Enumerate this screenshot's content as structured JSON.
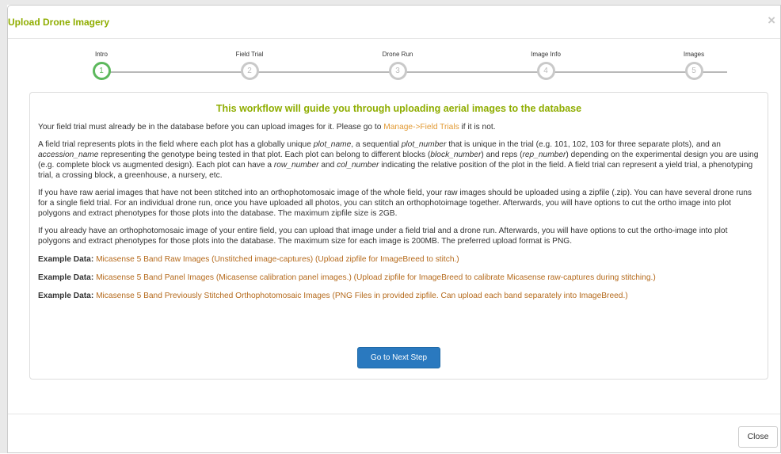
{
  "modal": {
    "title": "Upload Drone Imagery",
    "close_symbol": "×"
  },
  "steps": [
    {
      "label": "Intro",
      "number": "1",
      "active": true
    },
    {
      "label": "Field Trial",
      "number": "2",
      "active": false
    },
    {
      "label": "Drone Run",
      "number": "3",
      "active": false
    },
    {
      "label": "Image Info",
      "number": "4",
      "active": false
    },
    {
      "label": "Images",
      "number": "5",
      "active": false
    }
  ],
  "panel": {
    "title": "This workflow will guide you through uploading aerial images to the database",
    "p1": {
      "before": "Your field trial must already be in the database before you can upload images for it. Please go to ",
      "link": "Manage->Field Trials",
      "after": " if it is not."
    },
    "p2": {
      "t1": "A field trial represents plots in the field where each plot has a globally unique ",
      "i1": "plot_name",
      "t2": ", a sequential ",
      "i2": "plot_number",
      "t3": " that is unique in the trial (e.g. 101, 102, 103 for three separate plots), and an ",
      "i3": "accession_name",
      "t4": " representing the genotype being tested in that plot. Each plot can belong to different blocks (",
      "i4": "block_number",
      "t5": ") and reps (",
      "i5": "rep_number",
      "t6": ") depending on the experimental design you are using (e.g. complete block vs augmented design). Each plot can have a ",
      "i6": "row_number",
      "t7": " and ",
      "i7": "col_number",
      "t8": " indicating the relative position of the plot in the field. A field trial can represent a yield trial, a phenotyping trial, a crossing block, a greenhouse, a nursery, etc."
    },
    "p3": "If you have raw aerial images that have not been stitched into an orthophotomosaic image of the whole field, your raw images should be uploaded using a zipfile (.zip). You can have several drone runs for a single field trial. For an individual drone run, once you have uploaded all photos, you can stitch an orthophotoimage together. Afterwards, you will have options to cut the ortho image into plot polygons and extract phenotypes for those plots into the database. The maximum zipfile size is 2GB.",
    "p4": "If you already have an orthophotomosaic image of your entire field, you can upload that image under a field trial and a drone run. Afterwards, you will have options to cut the ortho-image into plot polygons and extract phenotypes for those plots into the database. The maximum size for each image is 200MB. The preferred upload format is PNG.",
    "examples": [
      {
        "label": "Example Data:",
        "link": "Micasense 5 Band Raw Images (Unstitched image-captures) (Upload zipfile for ImageBreed to stitch.)"
      },
      {
        "label": "Example Data:",
        "link": "Micasense 5 Band Panel Images (Micasense calibration panel images.) (Upload zipfile for ImageBreed to calibrate Micasense raw-captures during stitching.)"
      },
      {
        "label": "Example Data:",
        "link": "Micasense 5 Band Previously Stitched Orthophotomosaic Images (PNG Files in provided zipfile. Can upload each band separately into ImageBreed.)"
      }
    ],
    "next_button": "Go to Next Step"
  },
  "footer": {
    "close_button": "Close"
  },
  "colors": {
    "title_green": "#8fad00",
    "active_step": "#5cb85c",
    "link_orange": "#e29a34",
    "example_link": "#b56a1c",
    "primary_button": "#2a79bf"
  }
}
